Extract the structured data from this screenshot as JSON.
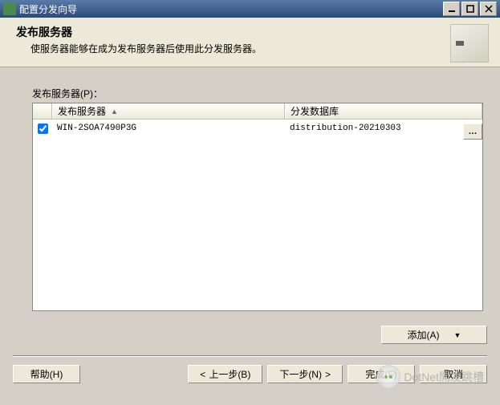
{
  "window": {
    "title": "配置分发向导"
  },
  "header": {
    "heading": "发布服务器",
    "subtext": "使服务器能够在成为发布服务器后使用此分发服务器。"
  },
  "list": {
    "label": "发布服务器(P)：",
    "columns": {
      "publisher": "发布服务器",
      "database": "分发数据库"
    },
    "rows": [
      {
        "checked": true,
        "publisher": "WIN-2SOA7490P3G",
        "database": "distribution-20210303"
      }
    ]
  },
  "buttons": {
    "add": "添加(A)",
    "help": "帮助(H)",
    "back": "上一步(B)",
    "next": "下一步(N)",
    "finish": "完成(F)",
    "cancel": "取消"
  },
  "watermark": {
    "text": "DotNet開发跳槽"
  }
}
